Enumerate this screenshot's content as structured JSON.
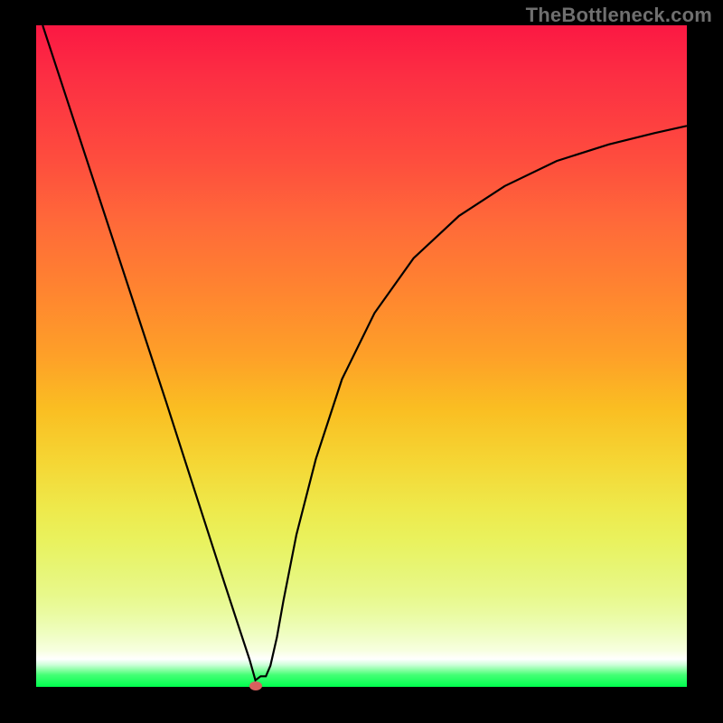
{
  "watermark": "TheBottleneck.com",
  "colors": {
    "frame_bg": "#000000",
    "gradient_top": "#fb1843",
    "gradient_bottom": "#00ff4e",
    "curve": "#000000",
    "marker": "#d8605e"
  },
  "marker": {
    "x_frac": 0.337,
    "y_frac": 0.998
  },
  "chart_data": {
    "type": "line",
    "title": "",
    "xlabel": "",
    "ylabel": "",
    "xlim": [
      0,
      1
    ],
    "ylim": [
      0,
      1
    ],
    "grid": false,
    "legend": false,
    "note": "Axes have no visible ticks or labels; values are estimated fractions of the plot width/height read from the curve geometry.",
    "series": [
      {
        "name": "curve",
        "x": [
          0.01,
          0.05,
          0.1,
          0.15,
          0.2,
          0.25,
          0.29,
          0.3,
          0.31,
          0.32,
          0.328,
          0.337,
          0.345,
          0.353,
          0.36,
          0.37,
          0.38,
          0.4,
          0.43,
          0.47,
          0.52,
          0.58,
          0.65,
          0.72,
          0.8,
          0.88,
          0.95,
          1.0
        ],
        "y": [
          1.0,
          0.88,
          0.73,
          0.58,
          0.43,
          0.277,
          0.155,
          0.125,
          0.095,
          0.065,
          0.041,
          0.01,
          0.016,
          0.016,
          0.032,
          0.075,
          0.13,
          0.23,
          0.345,
          0.465,
          0.565,
          0.648,
          0.712,
          0.757,
          0.795,
          0.82,
          0.837,
          0.848
        ]
      }
    ],
    "marker_point": {
      "x": 0.337,
      "y": 0.002
    }
  }
}
